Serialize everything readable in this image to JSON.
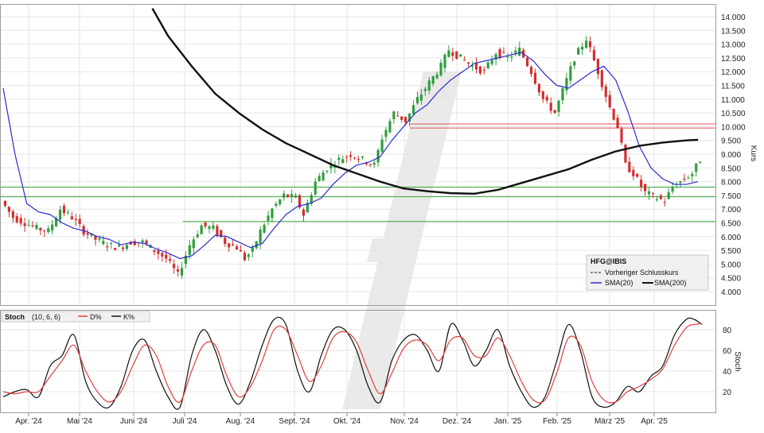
{
  "chart_data": [
    {
      "type": "candlestick",
      "ylabel": "Kurs",
      "ylim": [
        3500,
        14300
      ],
      "y_ticks": [
        "4.000",
        "4.500",
        "5.000",
        "5.500",
        "6.000",
        "6.500",
        "7.000",
        "7.500",
        "8.000",
        "8.500",
        "9.000",
        "9.500",
        "10.000",
        "10.500",
        "11.000",
        "11.500",
        "12.000",
        "12.500",
        "13.000",
        "13.500",
        "14.000"
      ],
      "x_labels": [
        "Apr. '24",
        "Mai '24",
        "Juni '24",
        "Juli '24",
        "Aug. '24",
        "Sept. '24",
        "Okt. '24",
        "Nov. '24",
        "Dez. '24",
        "Jan. '25",
        "Feb. '25",
        "März '25",
        "Apr. '25"
      ],
      "legend": {
        "symbol": "HFG@IBIS",
        "items": [
          {
            "label": "Vorheriger Schlusskurs",
            "color": "#444444",
            "style": "dashed"
          },
          {
            "label": "SMA(20)",
            "color": "#2a2ad0",
            "style": "solid"
          },
          {
            "label": "SMA(200)",
            "color": "#111111",
            "style": "solid"
          }
        ]
      },
      "horizontal_levels": [
        {
          "value": 10100,
          "color": "#e05555"
        },
        {
          "value": 9950,
          "color": "#e05555"
        },
        {
          "value": 7800,
          "color": "#3aa03a"
        },
        {
          "value": 7450,
          "color": "#3aa03a"
        },
        {
          "value": 6550,
          "color": "#3aa03a"
        }
      ],
      "price_path": [
        [
          0,
          7300
        ],
        [
          3,
          6700
        ],
        [
          6,
          6500
        ],
        [
          9,
          6300
        ],
        [
          12,
          6200
        ],
        [
          15,
          7000
        ],
        [
          18,
          6700
        ],
        [
          21,
          6200
        ],
        [
          24,
          5900
        ],
        [
          27,
          5700
        ],
        [
          30,
          5600
        ],
        [
          33,
          5800
        ],
        [
          36,
          5800
        ],
        [
          39,
          5500
        ],
        [
          42,
          5200
        ],
        [
          45,
          4600
        ],
        [
          48,
          5700
        ],
        [
          51,
          6400
        ],
        [
          54,
          6300
        ],
        [
          57,
          5800
        ],
        [
          60,
          5600
        ],
        [
          62,
          5200
        ],
        [
          64,
          5500
        ],
        [
          66,
          6200
        ],
        [
          69,
          7000
        ],
        [
          72,
          7500
        ],
        [
          75,
          7400
        ],
        [
          77,
          6800
        ],
        [
          80,
          8000
        ],
        [
          83,
          8500
        ],
        [
          86,
          8800
        ],
        [
          89,
          9000
        ],
        [
          92,
          8800
        ],
        [
          95,
          8600
        ],
        [
          97,
          9600
        ],
        [
          100,
          10500
        ],
        [
          103,
          10200
        ],
        [
          106,
          11000
        ],
        [
          109,
          11600
        ],
        [
          112,
          12200
        ],
        [
          114,
          12800
        ],
        [
          117,
          12500
        ],
        [
          120,
          12200
        ],
        [
          123,
          12000
        ],
        [
          126,
          12700
        ],
        [
          129,
          12500
        ],
        [
          132,
          12800
        ],
        [
          135,
          12000
        ],
        [
          138,
          11000
        ],
        [
          141,
          10500
        ],
        [
          143,
          11300
        ],
        [
          146,
          12500
        ],
        [
          149,
          13200
        ],
        [
          152,
          12000
        ],
        [
          155,
          10700
        ],
        [
          157,
          10000
        ],
        [
          159,
          8600
        ],
        [
          161,
          8300
        ],
        [
          164,
          7600
        ],
        [
          167,
          7400
        ],
        [
          169,
          7300
        ],
        [
          171,
          7800
        ],
        [
          173,
          8000
        ],
        [
          176,
          8300
        ],
        [
          178,
          8800
        ]
      ],
      "sma20": [
        [
          0,
          11400
        ],
        [
          3,
          9000
        ],
        [
          6,
          7200
        ],
        [
          9,
          6900
        ],
        [
          12,
          6800
        ],
        [
          15,
          6500
        ],
        [
          18,
          6300
        ],
        [
          21,
          6200
        ],
        [
          24,
          6000
        ],
        [
          27,
          5900
        ],
        [
          30,
          5700
        ],
        [
          33,
          5800
        ],
        [
          36,
          5750
        ],
        [
          39,
          5550
        ],
        [
          42,
          5400
        ],
        [
          45,
          5200
        ],
        [
          48,
          5300
        ],
        [
          51,
          5650
        ],
        [
          54,
          6050
        ],
        [
          57,
          6000
        ],
        [
          60,
          5800
        ],
        [
          63,
          5600
        ],
        [
          66,
          5750
        ],
        [
          69,
          6300
        ],
        [
          72,
          6800
        ],
        [
          75,
          7100
        ],
        [
          78,
          7200
        ],
        [
          81,
          7400
        ],
        [
          84,
          7900
        ],
        [
          87,
          8300
        ],
        [
          90,
          8600
        ],
        [
          93,
          8700
        ],
        [
          96,
          8900
        ],
        [
          99,
          9500
        ],
        [
          102,
          10000
        ],
        [
          105,
          10500
        ],
        [
          108,
          10800
        ],
        [
          111,
          11300
        ],
        [
          114,
          11700
        ],
        [
          117,
          12000
        ],
        [
          120,
          12300
        ],
        [
          123,
          12400
        ],
        [
          126,
          12500
        ],
        [
          129,
          12600
        ],
        [
          132,
          12700
        ],
        [
          135,
          12400
        ],
        [
          138,
          11900
        ],
        [
          141,
          11500
        ],
        [
          144,
          11400
        ],
        [
          147,
          11700
        ],
        [
          150,
          12000
        ],
        [
          153,
          12200
        ],
        [
          156,
          11700
        ],
        [
          159,
          10600
        ],
        [
          162,
          9300
        ],
        [
          165,
          8500
        ],
        [
          168,
          8100
        ],
        [
          171,
          7900
        ],
        [
          174,
          7900
        ],
        [
          177,
          8000
        ]
      ],
      "sma200": [
        [
          38,
          14300
        ],
        [
          42,
          13300
        ],
        [
          48,
          12200
        ],
        [
          54,
          11200
        ],
        [
          60,
          10500
        ],
        [
          66,
          9900
        ],
        [
          72,
          9400
        ],
        [
          78,
          9000
        ],
        [
          84,
          8600
        ],
        [
          90,
          8300
        ],
        [
          96,
          8000
        ],
        [
          102,
          7750
        ],
        [
          108,
          7650
        ],
        [
          114,
          7580
        ],
        [
          120,
          7560
        ],
        [
          126,
          7700
        ],
        [
          132,
          7950
        ],
        [
          138,
          8200
        ],
        [
          144,
          8450
        ],
        [
          150,
          8800
        ],
        [
          156,
          9100
        ],
        [
          162,
          9300
        ],
        [
          168,
          9420
        ],
        [
          174,
          9500
        ],
        [
          177,
          9520
        ]
      ]
    },
    {
      "type": "line",
      "title": "Stoch",
      "params": "(10, 6, 6)",
      "ylabel": "Stoch",
      "ylim": [
        0,
        100
      ],
      "y_ticks": [
        "20",
        "40",
        "60",
        "80"
      ],
      "series": [
        {
          "name": "K%",
          "color": "#111111",
          "points": [
            [
              0,
              15
            ],
            [
              3,
              20
            ],
            [
              6,
              22
            ],
            [
              9,
              15
            ],
            [
              12,
              45
            ],
            [
              15,
              55
            ],
            [
              18,
              75
            ],
            [
              21,
              30
            ],
            [
              24,
              10
            ],
            [
              27,
              5
            ],
            [
              30,
              25
            ],
            [
              33,
              60
            ],
            [
              36,
              70
            ],
            [
              39,
              40
            ],
            [
              42,
              15
            ],
            [
              45,
              5
            ],
            [
              48,
              55
            ],
            [
              51,
              80
            ],
            [
              54,
              60
            ],
            [
              57,
              25
            ],
            [
              60,
              8
            ],
            [
              63,
              30
            ],
            [
              66,
              65
            ],
            [
              69,
              90
            ],
            [
              72,
              85
            ],
            [
              75,
              40
            ],
            [
              78,
              20
            ],
            [
              81,
              55
            ],
            [
              84,
              80
            ],
            [
              87,
              80
            ],
            [
              90,
              60
            ],
            [
              93,
              25
            ],
            [
              96,
              10
            ],
            [
              99,
              50
            ],
            [
              102,
              70
            ],
            [
              105,
              75
            ],
            [
              108,
              60
            ],
            [
              111,
              40
            ],
            [
              114,
              85
            ],
            [
              117,
              70
            ],
            [
              120,
              45
            ],
            [
              123,
              60
            ],
            [
              126,
              80
            ],
            [
              129,
              45
            ],
            [
              132,
              20
            ],
            [
              135,
              5
            ],
            [
              138,
              15
            ],
            [
              141,
              50
            ],
            [
              144,
              85
            ],
            [
              147,
              60
            ],
            [
              150,
              15
            ],
            [
              153,
              5
            ],
            [
              156,
              10
            ],
            [
              159,
              25
            ],
            [
              162,
              20
            ],
            [
              165,
              35
            ],
            [
              168,
              45
            ],
            [
              171,
              75
            ],
            [
              174,
              90
            ],
            [
              176,
              90
            ],
            [
              178,
              85
            ]
          ]
        },
        {
          "name": "D%",
          "color": "#e04040",
          "points": [
            [
              0,
              20
            ],
            [
              3,
              18
            ],
            [
              6,
              20
            ],
            [
              9,
              20
            ],
            [
              12,
              35
            ],
            [
              15,
              50
            ],
            [
              18,
              65
            ],
            [
              21,
              40
            ],
            [
              24,
              20
            ],
            [
              27,
              10
            ],
            [
              30,
              20
            ],
            [
              33,
              45
            ],
            [
              36,
              65
            ],
            [
              39,
              55
            ],
            [
              42,
              25
            ],
            [
              45,
              10
            ],
            [
              48,
              40
            ],
            [
              51,
              65
            ],
            [
              54,
              65
            ],
            [
              57,
              35
            ],
            [
              60,
              15
            ],
            [
              63,
              25
            ],
            [
              66,
              50
            ],
            [
              69,
              80
            ],
            [
              72,
              80
            ],
            [
              75,
              55
            ],
            [
              78,
              30
            ],
            [
              81,
              45
            ],
            [
              84,
              72
            ],
            [
              87,
              78
            ],
            [
              90,
              68
            ],
            [
              93,
              40
            ],
            [
              96,
              18
            ],
            [
              99,
              38
            ],
            [
              102,
              62
            ],
            [
              105,
              70
            ],
            [
              108,
              65
            ],
            [
              111,
              50
            ],
            [
              114,
              70
            ],
            [
              117,
              72
            ],
            [
              120,
              55
            ],
            [
              123,
              55
            ],
            [
              126,
              72
            ],
            [
              129,
              55
            ],
            [
              132,
              30
            ],
            [
              135,
              12
            ],
            [
              138,
              12
            ],
            [
              141,
              38
            ],
            [
              144,
              72
            ],
            [
              147,
              65
            ],
            [
              150,
              30
            ],
            [
              153,
              12
            ],
            [
              156,
              10
            ],
            [
              159,
              20
            ],
            [
              162,
              25
            ],
            [
              165,
              32
            ],
            [
              168,
              42
            ],
            [
              171,
              65
            ],
            [
              174,
              82
            ],
            [
              176,
              85
            ],
            [
              178,
              86
            ]
          ]
        }
      ]
    }
  ]
}
